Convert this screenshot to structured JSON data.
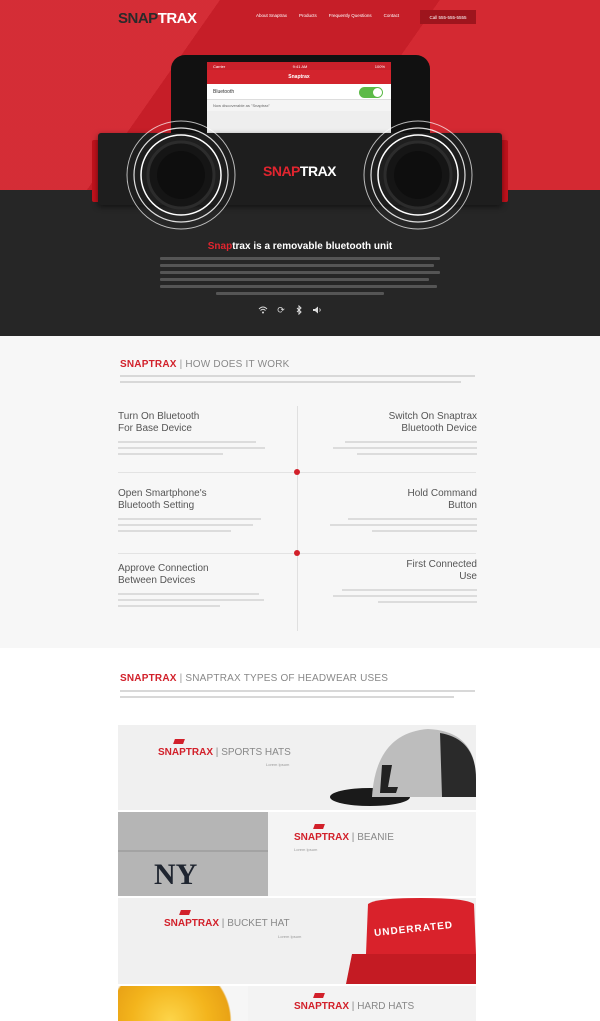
{
  "nav": {
    "logo_a": "SNAP",
    "logo_b": "TRAX",
    "links": [
      "About Snaptrax",
      "Products",
      "Frequently Questions",
      "Contact"
    ],
    "cta": "Call 555-555-5555"
  },
  "phone": {
    "status_left": "Carrier",
    "status_center": "9:41 AM",
    "status_right": "100%",
    "title": "Snaptrax",
    "row_label": "Bluetooth",
    "note": "Now discoverable as \"Snaptrax\""
  },
  "unit_logo": {
    "a": "SNAP",
    "b": "TRAX"
  },
  "hero": {
    "heading_hl": "Snap",
    "heading_rest": "trax is a removable bluetooth unit",
    "icons": [
      "wifi-icon",
      "refresh-icon",
      "bluetooth-icon",
      "volume-icon"
    ]
  },
  "how": {
    "brand": "SNAPTRAX",
    "sep": "|",
    "title": "HOW DOES IT WORK",
    "steps": [
      {
        "title_1": "Turn On Bluetooth",
        "title_2": "For Base Device"
      },
      {
        "title_1": "Switch On Snaptrax",
        "title_2": "Bluetooth Device"
      },
      {
        "title_1": "Open Smartphone's",
        "title_2": "Bluetooth Setting"
      },
      {
        "title_1": "Hold Command",
        "title_2": "Button"
      },
      {
        "title_1": "Approve Connection",
        "title_2": "Between Devices"
      },
      {
        "title_1": "First Connected",
        "title_2": "Use"
      }
    ]
  },
  "types": {
    "brand": "SNAPTRAX",
    "sep": "|",
    "title": "SNAPTRAX TYPES OF HEADWEAR USES",
    "cards": [
      {
        "brand": "SNAPTRAX",
        "sep": "|",
        "name": "SPORTS HATS",
        "sub": "Lorem Ipsum"
      },
      {
        "brand": "SNAPTRAX",
        "sep": "|",
        "name": "BEANIE",
        "sub": "Lorem Ipsum"
      },
      {
        "brand": "SNAPTRAX",
        "sep": "|",
        "name": "BUCKET HAT",
        "sub": "Lorem Ipsum"
      },
      {
        "brand": "SNAPTRAX",
        "sep": "|",
        "name": "HARD HATS",
        "sub": ""
      }
    ],
    "beanie_text": "NY",
    "bucket_text": "UNDERRATED"
  },
  "colors": {
    "brand_red": "#d2202a",
    "dark": "#262626",
    "toggle_green": "#5cba47"
  }
}
